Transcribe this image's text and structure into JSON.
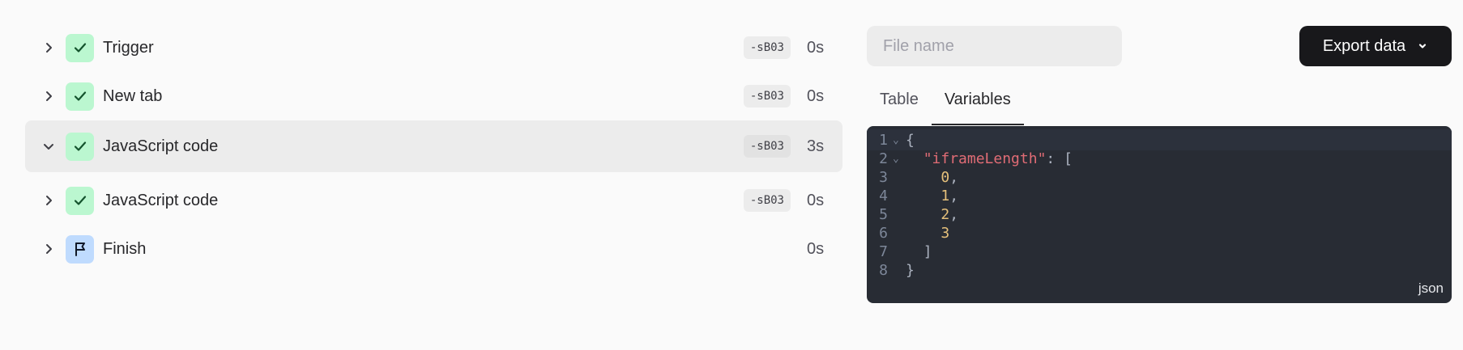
{
  "log": {
    "items": [
      {
        "label": "Trigger",
        "tag": "-sB03",
        "duration": "0s",
        "status": "success",
        "expanded": false,
        "icon": "check-icon"
      },
      {
        "label": "New tab",
        "tag": "-sB03",
        "duration": "0s",
        "status": "success",
        "expanded": false,
        "icon": "check-icon"
      },
      {
        "label": "JavaScript code",
        "tag": "-sB03",
        "duration": "3s",
        "status": "success",
        "expanded": true,
        "icon": "check-icon"
      },
      {
        "label": "JavaScript code",
        "tag": "-sB03",
        "duration": "0s",
        "status": "success",
        "expanded": false,
        "icon": "check-icon"
      },
      {
        "label": "Finish",
        "tag": "",
        "duration": "0s",
        "status": "finish",
        "expanded": false,
        "icon": "flag-icon"
      }
    ]
  },
  "output": {
    "file_name": {
      "value": "",
      "placeholder": "File name"
    },
    "export_label": "Export data",
    "tabs": [
      {
        "label": "Table",
        "active": false
      },
      {
        "label": "Variables",
        "active": true
      }
    ],
    "editor": {
      "language": "json",
      "lines": [
        {
          "n": "1",
          "text": "{"
        },
        {
          "n": "2",
          "key": "\"iframeLength\"",
          "text": ": ["
        },
        {
          "n": "3",
          "num": "0",
          "text": ","
        },
        {
          "n": "4",
          "num": "1",
          "text": ","
        },
        {
          "n": "5",
          "num": "2",
          "text": ","
        },
        {
          "n": "6",
          "num": "3",
          "text": ""
        },
        {
          "n": "7",
          "text": "]"
        },
        {
          "n": "8",
          "text": "}"
        }
      ]
    }
  },
  "colors": {
    "success_badge": "#bbf7d0",
    "finish_badge": "#bfdbfe",
    "export_button": "#18181b",
    "editor_bg": "#282c34",
    "json_key": "#e06c75",
    "json_number": "#e5c07b"
  }
}
